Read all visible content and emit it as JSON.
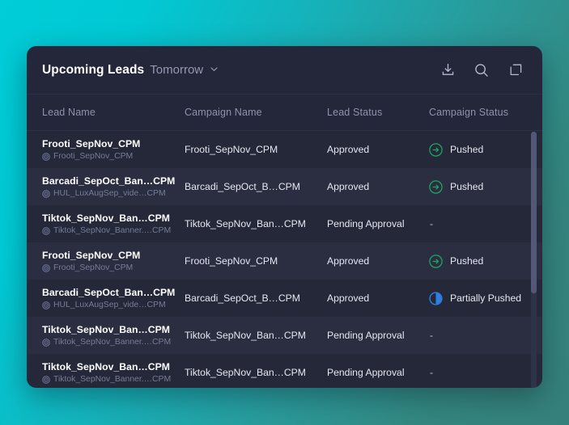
{
  "header": {
    "title": "Upcoming Leads",
    "subtitle": "Tomorrow",
    "chevron_icon": "chevron-down-icon",
    "actions": [
      {
        "name": "download-icon",
        "label": "Download"
      },
      {
        "name": "search-icon",
        "label": "Search"
      },
      {
        "name": "expand-icon",
        "label": "Expand"
      }
    ]
  },
  "table": {
    "columns": [
      {
        "key": "lead_name",
        "label": "Lead Name"
      },
      {
        "key": "campaign_name",
        "label": "Campaign Name"
      },
      {
        "key": "lead_status",
        "label": "Lead Status"
      },
      {
        "key": "campaign_status",
        "label": "Campaign Status"
      }
    ],
    "rows": [
      {
        "lead_name": "Frooti_SepNov_CPM",
        "lead_sub": "Frooti_SepNov_CPM",
        "campaign_name": "Frooti_SepNov_CPM",
        "lead_status": "Approved",
        "campaign_status": "Pushed",
        "campaign_status_icon": "arrow-right-circle-icon"
      },
      {
        "lead_name": "Barcadi_SepOct_Ban…CPM",
        "lead_sub": "HUL_LuxAugSep_vide…CPM",
        "campaign_name": "Barcadi_SepOct_B…CPM",
        "lead_status": "Approved",
        "campaign_status": "Pushed",
        "campaign_status_icon": "arrow-right-circle-icon"
      },
      {
        "lead_name": "Tiktok_SepNov_Ban…CPM",
        "lead_sub": "Tiktok_SepNov_Banner.…CPM",
        "campaign_name": "Tiktok_SepNov_Ban…CPM",
        "lead_status": "Pending Approval",
        "campaign_status": "-",
        "campaign_status_icon": "none"
      },
      {
        "lead_name": "Frooti_SepNov_CPM",
        "lead_sub": "Frooti_SepNov_CPM",
        "campaign_name": "Frooti_SepNov_CPM",
        "lead_status": "Approved",
        "campaign_status": "Pushed",
        "campaign_status_icon": "arrow-right-circle-icon"
      },
      {
        "lead_name": "Barcadi_SepOct_Ban…CPM",
        "lead_sub": "HUL_LuxAugSep_vide…CPM",
        "campaign_name": "Barcadi_SepOct_B…CPM",
        "lead_status": "Approved",
        "campaign_status": "Partially Pushed",
        "campaign_status_icon": "half-circle-icon"
      },
      {
        "lead_name": "Tiktok_SepNov_Ban…CPM",
        "lead_sub": "Tiktok_SepNov_Banner.…CPM",
        "campaign_name": "Tiktok_SepNov_Ban…CPM",
        "lead_status": "Pending Approval",
        "campaign_status": "-",
        "campaign_status_icon": "none"
      },
      {
        "lead_name": "Tiktok_SepNov_Ban…CPM",
        "lead_sub": "Tiktok_SepNov_Banner.…CPM",
        "campaign_name": "Tiktok_SepNov_Ban…CPM",
        "lead_status": "Pending Approval",
        "campaign_status": "-",
        "campaign_status_icon": "none"
      }
    ]
  },
  "colors": {
    "pushed_green": "#1da762",
    "partial_blue": "#2f7fe0",
    "panel_bg": "#242739",
    "row_bg": "#252839",
    "row_alt_bg": "#2b2e41",
    "backdrop_start": "#00cdd8",
    "backdrop_end": "#35807a"
  }
}
